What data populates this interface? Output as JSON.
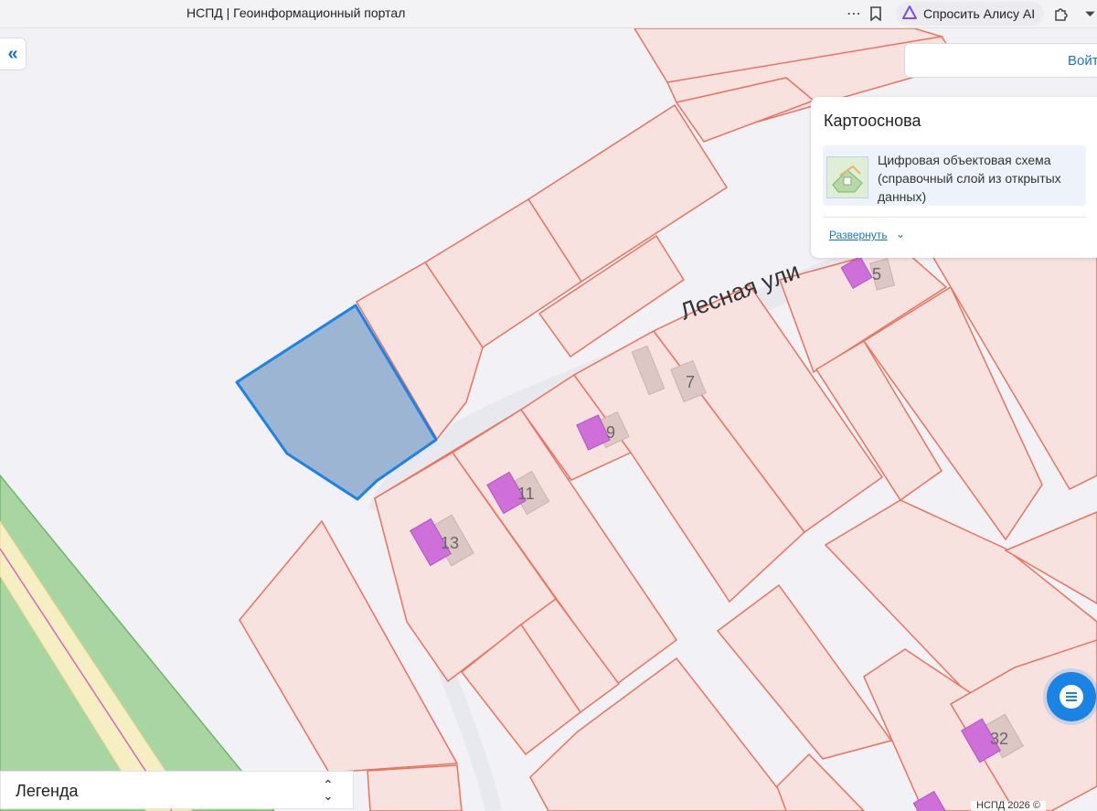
{
  "browser": {
    "tab_title": "НСПД | Геоинформационный портал",
    "alice_button": "Спросить Алису AI"
  },
  "header": {
    "login_label": "Войти"
  },
  "layers_panel": {
    "title": "Картооснова",
    "layer_name": "Цифровая объектовая схема (справочный слой из открытых данных)",
    "expand_label": "Развернуть"
  },
  "legend": {
    "label": "Легенда"
  },
  "map": {
    "street_label": "Лесная ули",
    "house_numbers": [
      "5",
      "7",
      "9",
      "11",
      "13",
      "32"
    ],
    "copyright": "НСПД 2026 ©",
    "colors": {
      "parcel_fill": "#f7e2e0",
      "parcel_stroke": "#e8735f",
      "building_fill": "#cf6fd9",
      "selected_fill": "#9bb5d3",
      "selected_stroke": "#1d82e6",
      "green_area": "#a8d5a2",
      "road_fill": "#f7efc4"
    }
  },
  "icons": [
    "collapse-left-icon",
    "more-icon",
    "bookmark-icon",
    "alice-icon",
    "extensions-icon",
    "chevron-down-icon",
    "sort-toggle-icon",
    "chat-icon"
  ]
}
